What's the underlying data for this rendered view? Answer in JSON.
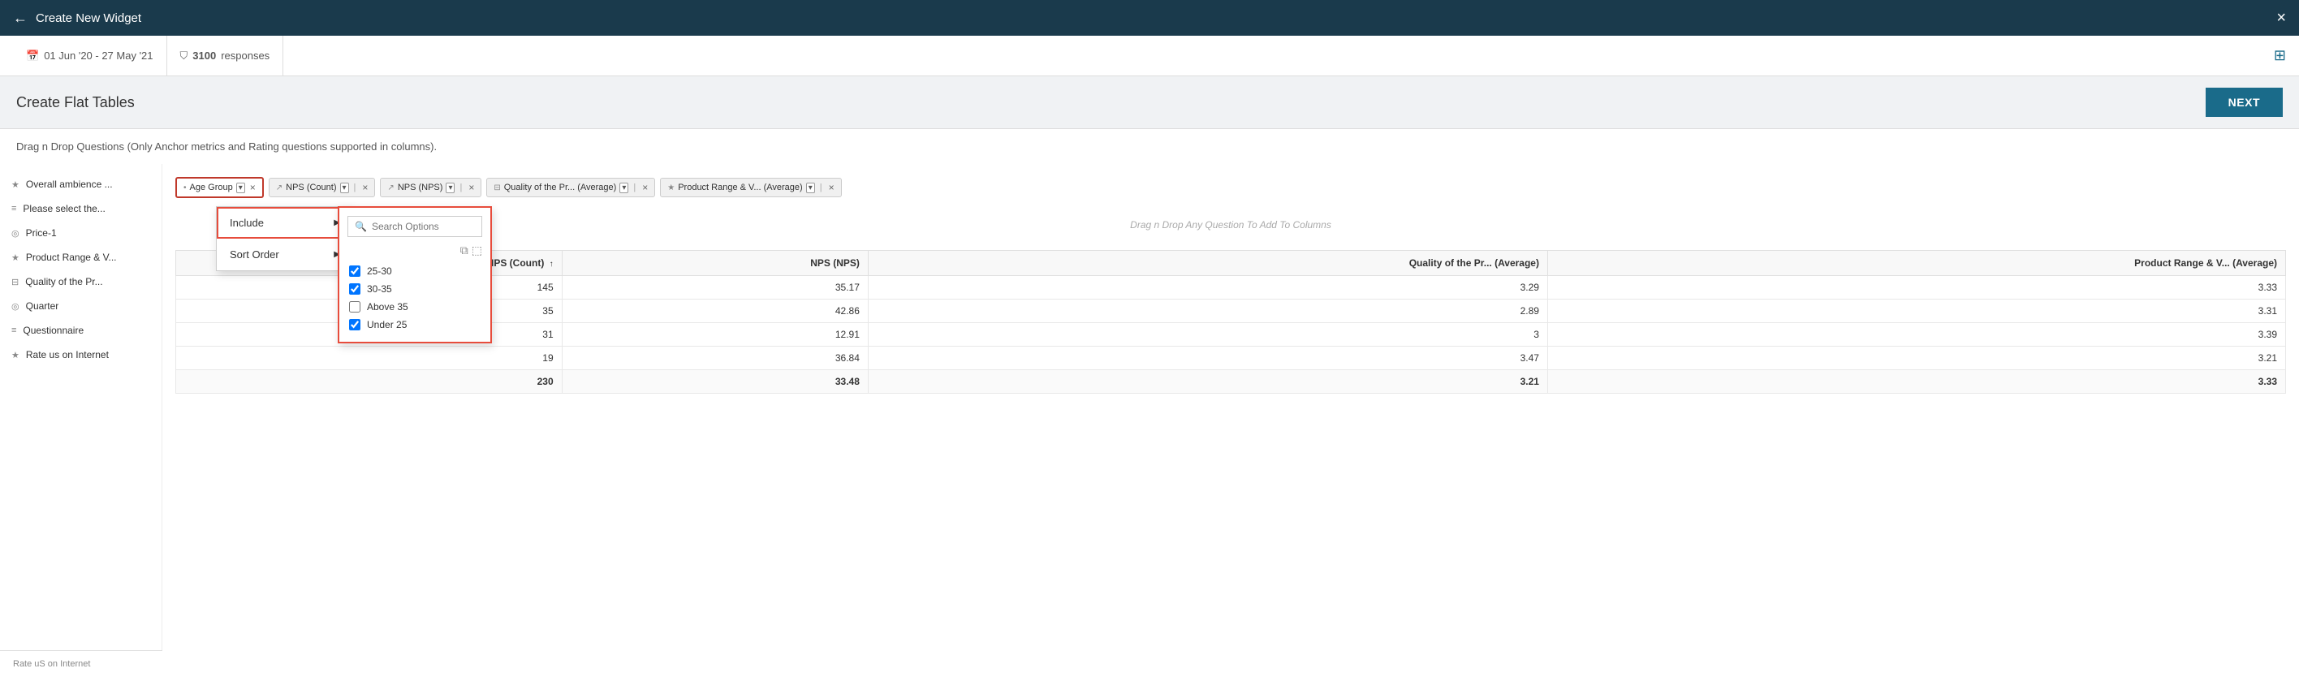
{
  "modal": {
    "title": "Create New Widget",
    "close_label": "×",
    "back_label": "←"
  },
  "subheader": {
    "date_range": "01 Jun '20 - 27 May '21",
    "responses_count": "3100",
    "responses_label": "responses"
  },
  "page": {
    "title": "Create Flat Tables",
    "next_label": "NEXT",
    "description": "Drag n Drop Questions (Only Anchor metrics and Rating questions supported in columns)."
  },
  "sidebar": {
    "items": [
      {
        "icon": "★",
        "label": "Overall ambience ..."
      },
      {
        "icon": "≡",
        "label": "Please select the..."
      },
      {
        "icon": "◎",
        "label": "Price-1"
      },
      {
        "icon": "★",
        "label": "Product Range & V..."
      },
      {
        "icon": "⊟",
        "label": "Quality of the Pr..."
      },
      {
        "icon": "◎",
        "label": "Quarter"
      },
      {
        "icon": "≡",
        "label": "Questionnaire"
      },
      {
        "icon": "★",
        "label": "Rate us on Internet"
      }
    ]
  },
  "columns": {
    "row_chip": {
      "label": "Age Group",
      "has_dropdown": true
    },
    "col_chips": [
      {
        "icon": "↗",
        "label": "NPS (Count)",
        "suffix": ""
      },
      {
        "icon": "↗",
        "label": "NPS (NPS)",
        "suffix": ""
      },
      {
        "icon": "⊟",
        "label": "Quality of the Pr... (Average)",
        "suffix": ""
      },
      {
        "icon": "★",
        "label": "Product Range & V... (Average)",
        "suffix": ""
      }
    ]
  },
  "dropdown": {
    "items": [
      {
        "label": "Include",
        "has_arrow": true,
        "active": true
      },
      {
        "label": "Sort Order",
        "has_arrow": true,
        "active": false
      }
    ]
  },
  "filter": {
    "search_placeholder": "Search Options",
    "options": [
      {
        "label": "25-30",
        "checked": true
      },
      {
        "label": "30-35",
        "checked": true
      },
      {
        "label": "Above 35",
        "checked": false
      },
      {
        "label": "Under 25",
        "checked": true
      }
    ]
  },
  "drag_hint": "Drag n Drop Any Question To Add To Columns",
  "table": {
    "headers": [
      {
        "label": "NPS (Count)",
        "sort": "↑",
        "align": "right"
      },
      {
        "label": "NPS (NPS)",
        "align": "right"
      },
      {
        "label": "Quality of the Pr... (Average)",
        "align": "right"
      },
      {
        "label": "Product Range & V... (Average)",
        "align": "right"
      }
    ],
    "rows": [
      {
        "cells": [
          "145",
          "35.17",
          "3.29",
          "3.33"
        ]
      },
      {
        "cells": [
          "35",
          "42.86",
          "2.89",
          "3.31"
        ]
      },
      {
        "cells": [
          "31",
          "12.91",
          "3",
          "3.39"
        ]
      },
      {
        "cells": [
          "19",
          "36.84",
          "3.47",
          "3.21"
        ]
      }
    ],
    "total_row": {
      "cells": [
        "230",
        "33.48",
        "3.21",
        "3.33"
      ]
    }
  },
  "watermark": {
    "label": "Rate uS on Internet"
  }
}
